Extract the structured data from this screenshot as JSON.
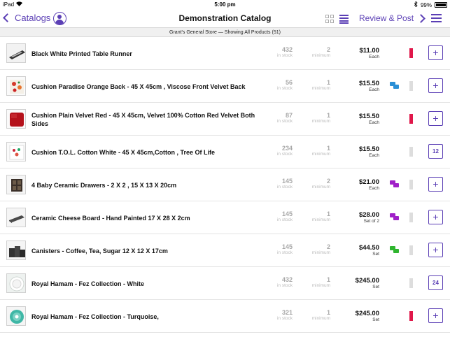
{
  "status_bar": {
    "device": "iPad",
    "time": "5:00 pm",
    "battery": "99%"
  },
  "nav": {
    "back_label": "Catalogs",
    "title": "Demonstration Catalog",
    "review_label": "Review & Post"
  },
  "subheader": "Grant's General Store — Showing All Products (51)",
  "labels": {
    "in_stock": "in stock",
    "minimum": "minimum"
  },
  "colors": {
    "accent": "#5b3fb5",
    "flag_red": "#e0174a",
    "flag_gray": "#dddddd",
    "chat_blue": "#2a8fd6",
    "chat_purple": "#a020c8",
    "chat_green": "#2fb52f"
  },
  "products": [
    {
      "name": "Black White Printed Table Runner",
      "stock": "432",
      "minimum": "2",
      "price": "$11.00",
      "unit": "Each",
      "chat": "none",
      "flag": "red",
      "button": "+",
      "thumb": "runner"
    },
    {
      "name": "Cushion Paradise Orange Back -  45 X 45cm , Viscose Front Velvet Back",
      "stock": "56",
      "minimum": "1",
      "price": "$15.50",
      "unit": "Each",
      "chat": "blue",
      "flag": "gray",
      "button": "+",
      "thumb": "cushion-floral"
    },
    {
      "name": "Cushion Plain Velvet Red - 45 X 45cm, Velvet 100% Cotton Red Velvet Both Sides",
      "stock": "87",
      "minimum": "1",
      "price": "$15.50",
      "unit": "Each",
      "chat": "none",
      "flag": "red",
      "button": "+",
      "thumb": "cushion-red"
    },
    {
      "name": "Cushion T.O.L. Cotton White - 45 X 45cm,Cotton , Tree Of Life",
      "stock": "234",
      "minimum": "1",
      "price": "$15.50",
      "unit": "Each",
      "chat": "none",
      "flag": "gray",
      "button": "12",
      "thumb": "cushion-white"
    },
    {
      "name": "4 Baby Ceramic Drawers - 2 X 2 , 15 X 13 X 20cm",
      "stock": "145",
      "minimum": "2",
      "price": "$21.00",
      "unit": "Each",
      "chat": "purple",
      "flag": "gray",
      "button": "+",
      "thumb": "drawers"
    },
    {
      "name": "Ceramic Cheese Board - Hand Painted 17 X 28 X 2cm",
      "stock": "145",
      "minimum": "1",
      "price": "$28.00",
      "unit": "Set of 2",
      "chat": "purple",
      "flag": "gray",
      "button": "+",
      "thumb": "board"
    },
    {
      "name": "Canisters - Coffee, Tea, Sugar 12 X 12 X 17cm",
      "stock": "145",
      "minimum": "2",
      "price": "$44.50",
      "unit": "Set",
      "chat": "green",
      "flag": "gray",
      "button": "+",
      "thumb": "canisters"
    },
    {
      "name": "Royal Hamam - Fez Collection - White",
      "stock": "432",
      "minimum": "1",
      "price": "$245.00",
      "unit": "Set",
      "chat": "none",
      "flag": "gray",
      "button": "24",
      "thumb": "towels-white"
    },
    {
      "name": "Royal Hamam - Fez Collection - Turquoise,",
      "stock": "321",
      "minimum": "1",
      "price": "$245.00",
      "unit": "Set",
      "chat": "none",
      "flag": "red",
      "button": "+",
      "thumb": "towels-turquoise"
    }
  ]
}
